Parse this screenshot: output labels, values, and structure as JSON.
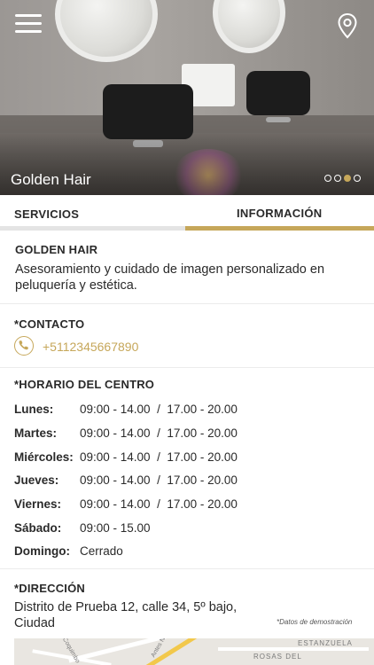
{
  "hero": {
    "title": "Golden Hair",
    "carousel": {
      "count": 4,
      "active_index": 2
    }
  },
  "tabs": [
    {
      "label": "SERVICIOS",
      "active": false
    },
    {
      "label": "INFORMACIÓN",
      "active": true
    }
  ],
  "business": {
    "name": "GOLDEN HAIR",
    "description_line1": "Asesoramiento y cuidado de imagen personalizado en",
    "description_line2": "peluquería y estética."
  },
  "contact": {
    "heading": "*CONTACTO",
    "phone": "+5112345667890"
  },
  "schedule": {
    "heading": "*HORARIO DEL CENTRO",
    "rows": [
      {
        "day": "Lunes:",
        "hours": "09:00 - 14.00  /  17.00 - 20.00"
      },
      {
        "day": "Martes:",
        "hours": "09:00 - 14.00  /  17.00 - 20.00"
      },
      {
        "day": "Miércoles:",
        "hours": "09:00 - 14.00  /  17.00 - 20.00"
      },
      {
        "day": "Jueves:",
        "hours": "09:00 - 14.00  /  17.00 - 20.00"
      },
      {
        "day": "Viernes:",
        "hours": "09:00 - 14.00  /  17.00 - 20.00"
      },
      {
        "day": "Sábado:",
        "hours": "09:00 - 15.00"
      },
      {
        "day": "Domingo:",
        "hours": "Cerrado"
      }
    ]
  },
  "address": {
    "heading": "*DIRECCIÓN",
    "line1": "Distrito de Prueba 12, calle 34, 5º bajo,",
    "line2": "Ciudad",
    "demo_note": "*Datos de demostración"
  },
  "map": {
    "labels": [
      "ESTANZUELA",
      "ROSAS DEL",
      "Coquimbo",
      "Antes Ni"
    ]
  },
  "colors": {
    "accent": "#c6a75a",
    "text": "#2a2a2a",
    "inactive_tab_bar": "#e4e4e4"
  },
  "icons": {
    "menu": "hamburger-icon",
    "location": "map-pin-icon",
    "phone": "phone-icon"
  }
}
